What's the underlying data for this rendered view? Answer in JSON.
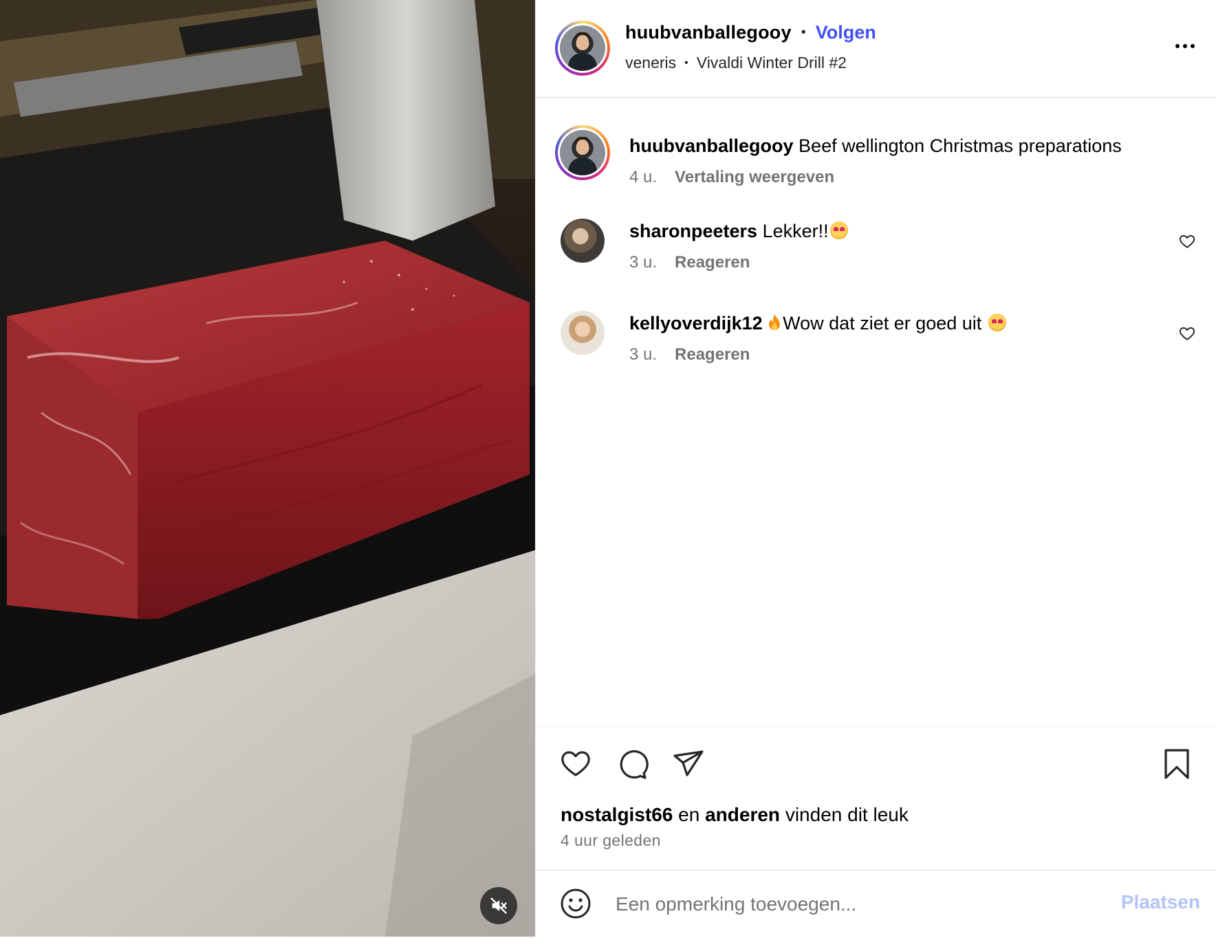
{
  "post": {
    "author": "huubvanballegooy",
    "follow_label": "Volgen",
    "separator": "•",
    "audio_artist": "veneris",
    "audio_track": "Vivaldi Winter Drill #2"
  },
  "caption": {
    "username": "huubvanballegooy",
    "text": "Beef wellington Christmas preparations",
    "time": "4 u.",
    "action": "Vertaling weergeven"
  },
  "comments": [
    {
      "username": "sharonpeeters",
      "text": "Lekker!!",
      "emoji_after": "heart-eyes",
      "time": "3 u.",
      "action": "Reageren"
    },
    {
      "username": "kellyoverdijk12",
      "emoji_before": "fire",
      "text": "Wow dat ziet er goed uit",
      "emoji_after": "heart-eyes",
      "time": "3 u.",
      "action": "Reageren"
    }
  ],
  "likes": {
    "user": "nostalgist66",
    "connector": "en",
    "others": "anderen",
    "suffix": "vinden dit leuk"
  },
  "time_ago": "4 uur geleden",
  "comment_box": {
    "placeholder": "Een opmerking toevoegen...",
    "post_label": "Plaatsen"
  },
  "colors": {
    "follow": "#4150f7",
    "post_disabled": "#b3c4f8",
    "meta_gray": "#737373"
  },
  "icons": [
    "heart-icon",
    "comment-icon",
    "share-icon",
    "bookmark-icon",
    "more-icon",
    "smiley-icon",
    "mute-icon"
  ]
}
